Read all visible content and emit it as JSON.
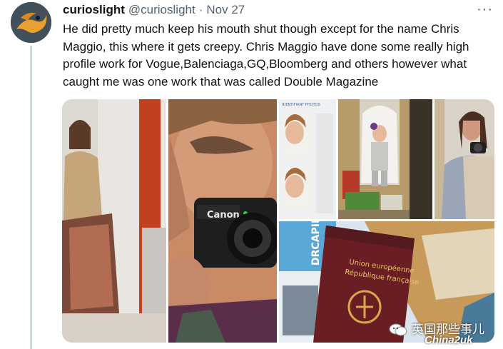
{
  "tweet": {
    "display_name": "curioslight",
    "handle": "@curioslight",
    "separator": "·",
    "date": "Nov 27",
    "more_glyph": "···",
    "text": "He did pretty much keep his mouth shut though except for the name Chris Maggio, this where it gets creepy. Chris Maggio have done some really high profile work for Vogue,Balenciaga,GQ,Bloomberg and others however what caught me was one work that was called Double Magazine"
  },
  "images": [
    {
      "icon": "woman-seated-photo"
    },
    {
      "icon": "camera-closeup-photo"
    },
    {
      "icon": "passport-photos"
    },
    {
      "icon": "child-in-costume-photo"
    },
    {
      "icon": "woman-with-camera-photo"
    },
    {
      "icon": "passport-collage-photo"
    }
  ],
  "camera_brand": "Canon",
  "passport": {
    "line1": "Union européenne",
    "line2": "République française"
  },
  "photo_strip_title": "IDENTIFIANT PHOTOS",
  "doc_label": "DRCAPIL",
  "watermark": {
    "text": "英国那些事儿",
    "url": "China2uk"
  },
  "colors": {
    "avatar_bg": "#3b4a57",
    "name": "#0f1419",
    "meta": "#536471",
    "thread_line": "#cfd9de"
  }
}
